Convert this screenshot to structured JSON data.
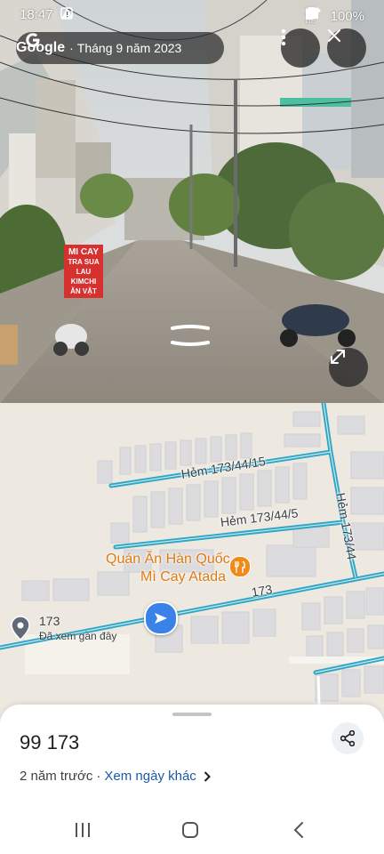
{
  "status_bar": {
    "time": "18:47",
    "network_label": "Vo)) LTE+ LTE",
    "battery": "100%"
  },
  "header": {
    "app_name": "Google",
    "separator": "·",
    "capture_date": "Tháng 9 năm 2023"
  },
  "panorama": {
    "shop_sign_lines": [
      "MI CAY",
      "TRA SUA",
      "LAU KIMCHI",
      "ĂN VẶT"
    ]
  },
  "map": {
    "streets": [
      "Hẻm 173/44/15",
      "Hẻm 173/44/5",
      "Hẻm 173/44",
      "173"
    ],
    "poi": {
      "name_line1": "Quán Ăn Hàn Quốc",
      "name_line2": "Mì Cay Atada",
      "icon": "restaurant-icon"
    },
    "place": {
      "label": "173",
      "sublabel": "Đã xem gần đây"
    }
  },
  "sheet": {
    "title": "99 173",
    "time_ago": "2 năm trước",
    "separator": "·",
    "other_dates_link": "Xem ngày khác"
  },
  "colors": {
    "road_blue": "#2fa6c4",
    "poi_orange": "#f08a18",
    "arrow_blue": "#3b82e8",
    "link_blue": "#1a5aa6"
  },
  "icons": {
    "more": "more-vert-icon",
    "close": "close-icon",
    "expand": "expand-icon",
    "share": "share-icon",
    "recents": "recents-icon",
    "home": "home-icon",
    "back": "back-icon"
  }
}
